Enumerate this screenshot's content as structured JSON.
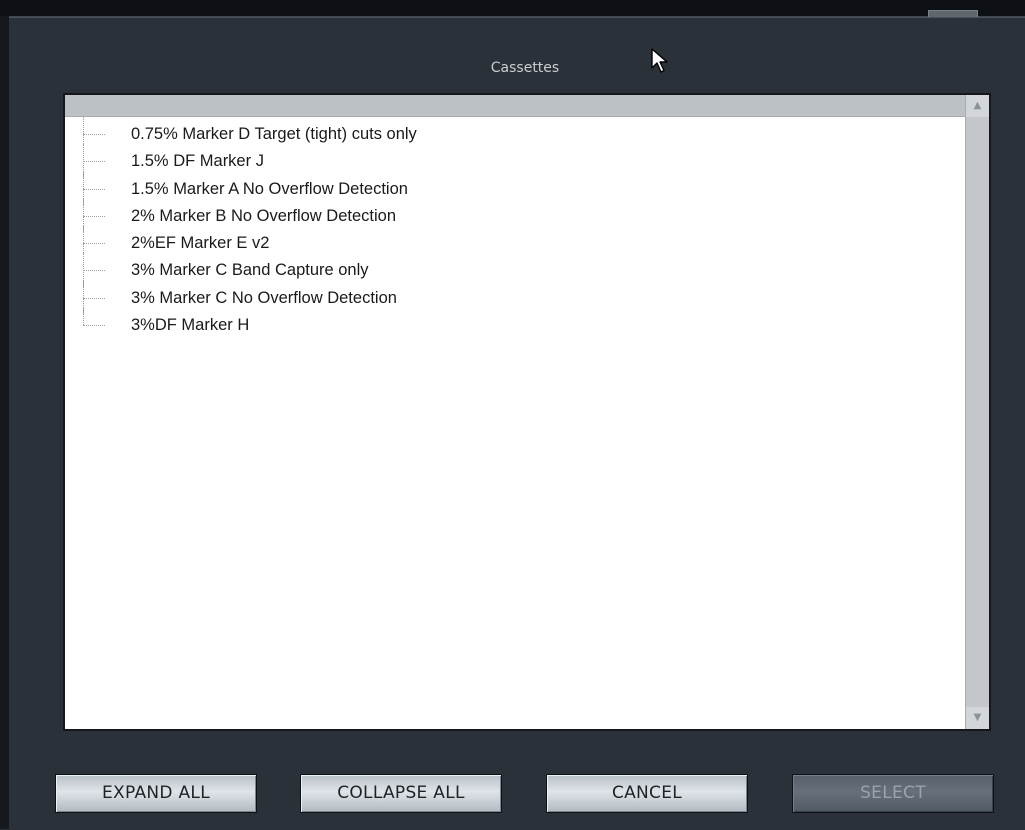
{
  "dialog": {
    "title": "Cassettes"
  },
  "cassette_list": {
    "items": [
      {
        "label": "0.75% Marker D Target (tight) cuts only"
      },
      {
        "label": "1.5% DF Marker J"
      },
      {
        "label": "1.5% Marker A No Overflow Detection"
      },
      {
        "label": "2% Marker B No Overflow Detection"
      },
      {
        "label": "2%EF Marker E v2"
      },
      {
        "label": "3% Marker C Band Capture only"
      },
      {
        "label": "3% Marker C No Overflow Detection"
      },
      {
        "label": "3%DF Marker H"
      }
    ],
    "scroll_up_icon": "triangle-up",
    "scroll_down_icon": "triangle-down"
  },
  "buttons": {
    "expand_all": "EXPAND ALL",
    "collapse_all": "COLLAPSE ALL",
    "cancel": "CANCEL",
    "select": "SELECT",
    "select_disabled": true
  },
  "colors": {
    "background": "#2b3138",
    "list_background": "#ffffff",
    "button_face": "#dfe4e8",
    "disabled_button_face": "#66707a"
  }
}
